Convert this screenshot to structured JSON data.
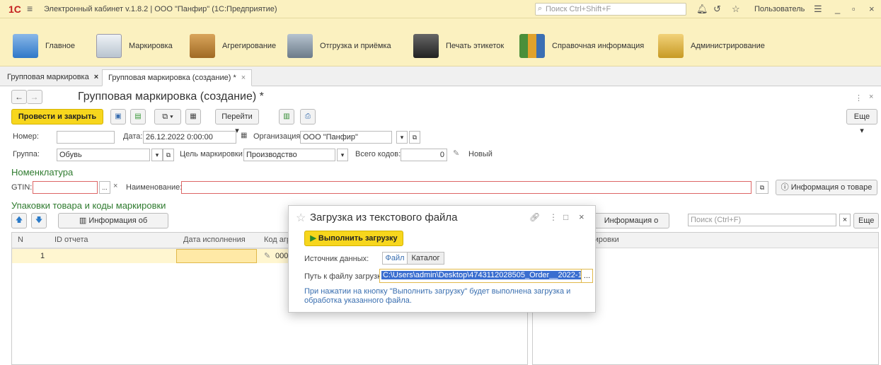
{
  "window": {
    "logo": "1С",
    "title": "Электронный кабинет v.1.8.2 | ООО \"Панфир\" (1С:Предприятие)",
    "search_placeholder": "Поиск Ctrl+Shift+F",
    "user": "Пользователь"
  },
  "sections": [
    {
      "label": "Главное",
      "icon": "home-icon"
    },
    {
      "label": "Маркировка",
      "icon": "checklist-icon"
    },
    {
      "label": "Агрегирование",
      "icon": "box-icon"
    },
    {
      "label": "Отгрузка и приёмка",
      "icon": "truck-icon"
    },
    {
      "label": "Печать этикеток",
      "icon": "printer-icon"
    },
    {
      "label": "Справочная информация",
      "icon": "books-icon"
    },
    {
      "label": "Администрирование",
      "icon": "database-icon"
    }
  ],
  "tabs": [
    {
      "label": "Групповая маркировка",
      "close": "×"
    },
    {
      "label": "Групповая маркировка (создание) *",
      "close": "×"
    }
  ],
  "form": {
    "title": "Групповая маркировка (создание) *",
    "toolbar": {
      "post_close": "Провести и закрыть",
      "goto": "Перейти",
      "more": "Еще"
    },
    "fields": {
      "number_label": "Номер:",
      "number_value": "",
      "date_label": "Дата:",
      "date_value": "26.12.2022  0:00:00",
      "org_label": "Организация:",
      "org_value": "ООО \"Панфир\"",
      "group_label": "Группа:",
      "group_value": "Обувь",
      "purpose_label": "Цель маркировки:",
      "purpose_value": "Производство",
      "total_label": "Всего кодов:",
      "total_value": "0",
      "status": "Новый"
    },
    "nomenclature": {
      "header": "Номенклатура",
      "gtin_label": "GTIN:",
      "name_label": "Наименование:",
      "info_btn": "Информация о товаре"
    },
    "packages": {
      "header": "Упаковки товара и коды маркировки",
      "aggregate_info_btn": "Информация об агрегате",
      "code_info_btn": "Информация о коде",
      "search_placeholder": "Поиск (Ctrl+F)",
      "more": "Еще",
      "columns": [
        "N",
        "ID отчета",
        "Дата исполнения",
        "Код агрег"
      ],
      "right_column": "маркировки",
      "rows": [
        {
          "n": "1",
          "id": "",
          "date": "",
          "code": "0004…"
        }
      ]
    }
  },
  "dialog": {
    "title": "Загрузка из текстового файла",
    "run_btn": "Выполнить загрузку",
    "source_label": "Источник данных:",
    "source_options": [
      "Файл",
      "Каталог"
    ],
    "source_selected": "Файл",
    "path_label": "Путь к файлу загрузки:",
    "path_value": "C:\\Users\\admin\\Desktop\\4743112028505_Order__2022-1",
    "browse": "...",
    "hint": "При нажатии на кнопку \"Выполнить загрузку\" будет выполнена загрузка и обработка указанного файла."
  },
  "colors": {
    "accent_yellow": "#f7d61d",
    "title_bg": "#fbf1c0",
    "section_green": "#2f7b2f",
    "link_blue": "#3a6fb0"
  }
}
